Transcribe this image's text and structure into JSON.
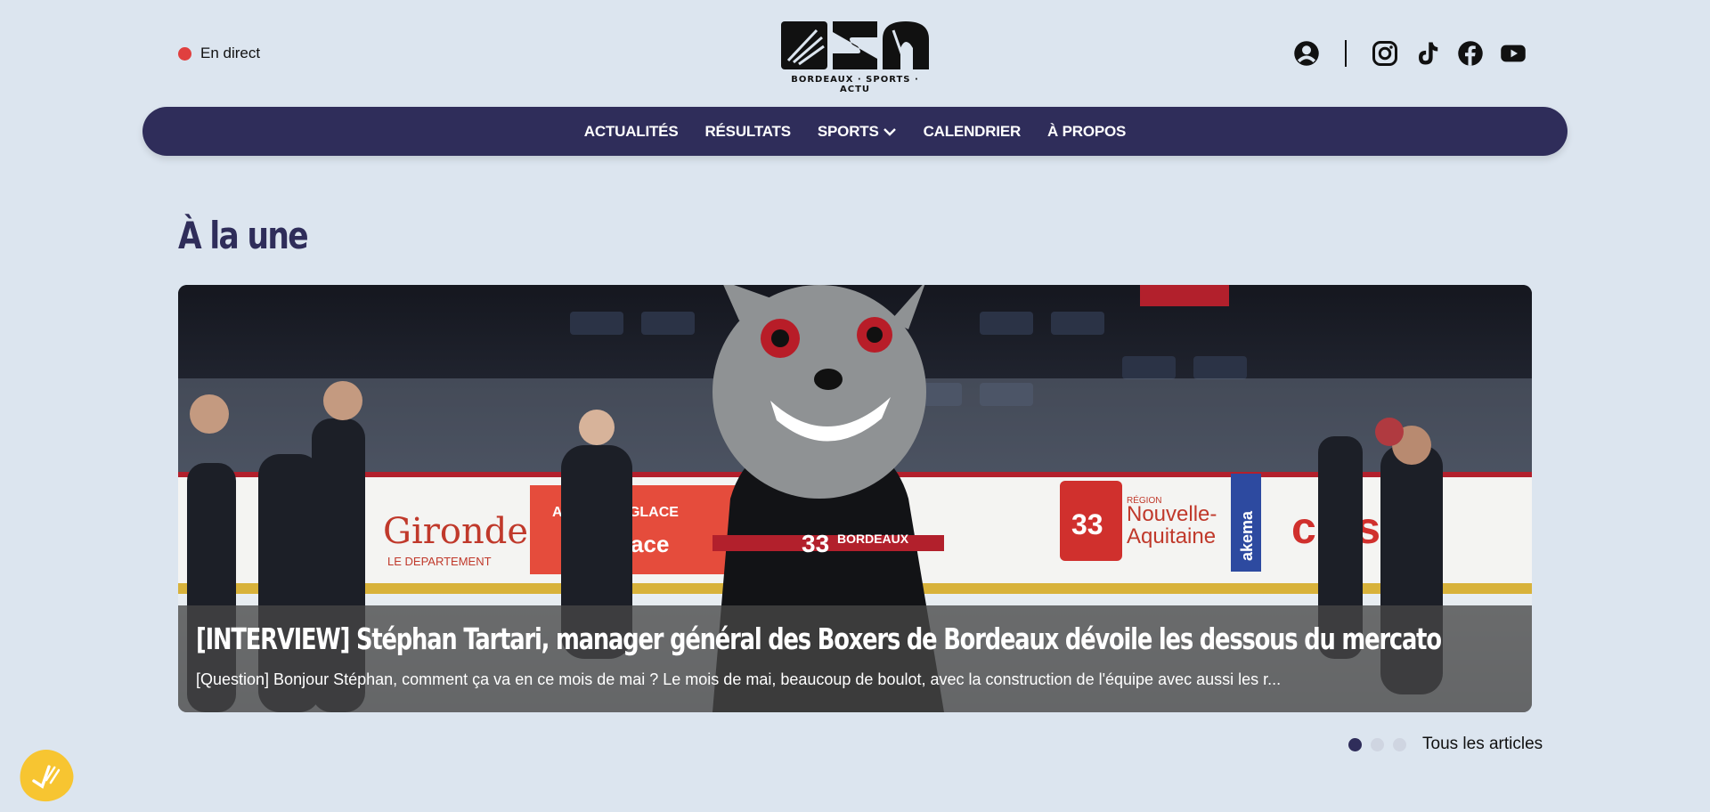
{
  "header": {
    "live_label": "En direct",
    "logo_text": "BORDEAUX · SPORTS · ACTU",
    "social_icons": [
      "user-icon",
      "instagram-icon",
      "tiktok-icon",
      "facebook-icon",
      "youtube-icon"
    ]
  },
  "nav": {
    "items": [
      "ACTUALITÉS",
      "RÉSULTATS",
      "SPORTS",
      "CALENDRIER",
      "À PROPOS"
    ],
    "dropdown_icon": "chevron-down-icon",
    "background": "#2f2d5a"
  },
  "main": {
    "section_title": "À la une",
    "featured": {
      "title": "[INTERVIEW] Stéphan Tartari, manager général des Boxers de Bordeaux dévoile les dessous du mercato",
      "excerpt": "[Question] Bonjour Stéphan, comment ça va en ce mois de mai ? Le mois de mai, beaucoup de boulot, avec la construction de l'équipe avec aussi les r...",
      "image_signs": [
        "Gironde",
        "LE DEPARTEMENT",
        "ASEY SUR GLACE",
        "energlace",
        "Nouvelle-Aquitaine",
        "RÉGION",
        "akema",
        "close",
        "33",
        "BORDEAUX"
      ]
    },
    "pager": {
      "slides": 3,
      "active_index": 0,
      "all_articles_label": "Tous les articles"
    }
  },
  "colors": {
    "page_background": "#dce5ef",
    "accent": "#2f2d5a",
    "live_dot": "#e0403f",
    "cookie_button": "#f7c531"
  }
}
